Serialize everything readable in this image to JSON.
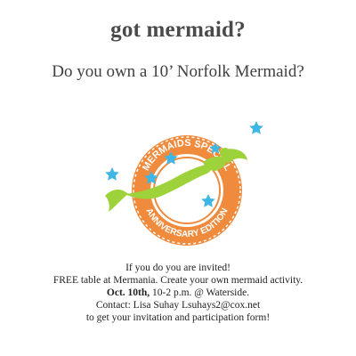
{
  "header": {
    "title": "got mermaid?",
    "subtitle": "Do you own a 10’ Norfolk Mermaid?"
  },
  "seal": {
    "top_text": "MERMAIDS SPECIAL",
    "bottom_text": "ANNIVERSARY EDITION",
    "colors": {
      "orange": "#f08a3c",
      "mermaid_green": "#9ed23a",
      "star_blue": "#3fb7e6"
    }
  },
  "body": {
    "line1": "If you do you are invited!",
    "line2": "FREE table at Mermania. Create your own mermaid activity.",
    "line3_date": "Oct. 10th,",
    "line3_rest": " 10-2 p.m. @ Waterside.",
    "line4": "Contact: Lisa Suhay Lsuhays2@cox.net",
    "line5": "to get your invitation and participation form!"
  }
}
